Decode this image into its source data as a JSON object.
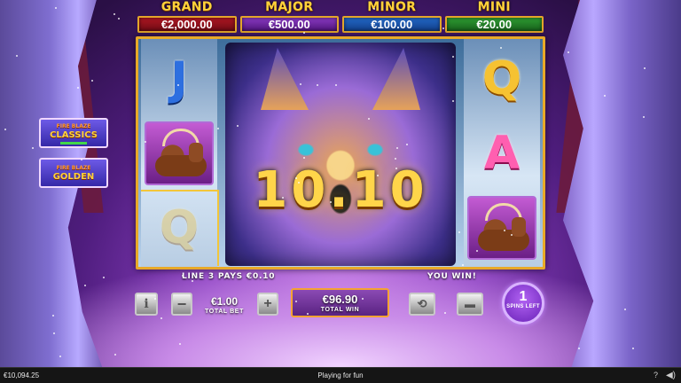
{
  "jackpots": [
    {
      "label": "GRAND",
      "value": "€2,000.00"
    },
    {
      "label": "MAJOR",
      "value": "€500.00"
    },
    {
      "label": "MINOR",
      "value": "€100.00"
    },
    {
      "label": "MINI",
      "value": "€20.00"
    }
  ],
  "reels": {
    "reel1": [
      "J",
      "elk",
      "Q"
    ],
    "reel5": [
      "Q",
      "A",
      "elk"
    ],
    "big_symbol": "wolf-icon"
  },
  "win_amount": "10.10",
  "side_buttons": {
    "classics": {
      "line1": "FIRE BLAZE",
      "line2": "CLASSICS"
    },
    "golden": {
      "line1": "FIRE BLAZE",
      "line2": "GOLDEN"
    }
  },
  "messages": {
    "line_pays": "LINE 3 PAYS €0.10",
    "you_win": "YOU WIN!"
  },
  "controls": {
    "info_icon": "i",
    "minus_icon": "−",
    "plus_icon": "+",
    "autoplay_icon": "⟲",
    "turbo_icon": "▬",
    "total_bet_value": "€1.00",
    "total_bet_label": "TOTAL BET",
    "total_win_value": "€96.90",
    "total_win_label": "TOTAL WIN",
    "spins_left_value": "1",
    "spins_left_label": "SPINS LEFT"
  },
  "statusbar": {
    "balance": "€10,094.25",
    "mode": "Playing for fun",
    "help": "?",
    "sound": "◀)"
  },
  "colors": {
    "frame_gold": "#e8a928",
    "win_gold": "#ffd54a",
    "grand_red": "#b01723",
    "major_purple": "#8b3bc4",
    "minor_blue": "#2369c9",
    "mini_green": "#2f9e33"
  }
}
